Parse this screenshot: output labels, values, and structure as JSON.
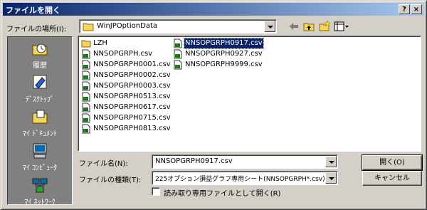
{
  "window": {
    "title": "ファイルを開く",
    "help_button": "?",
    "close_button": "×"
  },
  "location": {
    "label": "ファイルの場所(I):",
    "value": "WinJPOptionData",
    "folder_icon": "folder-icon"
  },
  "toolbar": {
    "back_icon": "back-arrow-icon",
    "up_icon": "up-folder-icon",
    "new_folder_icon": "new-folder-icon",
    "view_icon": "view-menu-icon"
  },
  "places": [
    {
      "label": "履歴",
      "icon": "history-icon"
    },
    {
      "label": "ﾃﾞｽｸﾄｯﾌﾟ",
      "icon": "desktop-icon"
    },
    {
      "label": "ﾏｲ ﾄﾞｷｭﾒﾝﾄ",
      "icon": "my-documents-icon"
    },
    {
      "label": "ﾏｲ ｺﾝﾋﾟｭｰﾀ",
      "icon": "my-computer-icon"
    },
    {
      "label": "ﾏｲ ﾈｯﾄﾜｰｸ",
      "icon": "my-network-icon"
    }
  ],
  "files": [
    {
      "name": "LZH",
      "type": "folder"
    },
    {
      "name": "NNSOPGRPH.csv",
      "type": "csv"
    },
    {
      "name": "NNSOPGRPH0001.csv",
      "type": "csv"
    },
    {
      "name": "NNSOPGRPH0002.csv",
      "type": "csv"
    },
    {
      "name": "NNSOPGRPH0003.csv",
      "type": "csv"
    },
    {
      "name": "NNSOPGRPH0513.csv",
      "type": "csv"
    },
    {
      "name": "NNSOPGRPH0617.csv",
      "type": "csv"
    },
    {
      "name": "NNSOPGRPH0715.csv",
      "type": "csv"
    },
    {
      "name": "NNSOPGRPH0813.csv",
      "type": "csv"
    },
    {
      "name": "NNSOPGRPH0917.csv",
      "type": "csv",
      "selected": true
    },
    {
      "name": "NNSOPGRPH0927.csv",
      "type": "csv"
    },
    {
      "name": "NNSOPGRPH9999.csv",
      "type": "csv"
    }
  ],
  "filename": {
    "label": "ファイル名(N):",
    "value": "NNSOPGRPH0917.csv"
  },
  "filetype": {
    "label": "ファイルの種類(T):",
    "value": "225オプション損益グラフ専用シート(NNSOPGRPH*.csv)"
  },
  "readonly": {
    "label": "読み取り専用ファイルとして開く(R)",
    "checked": false
  },
  "buttons": {
    "open": "開く(O)",
    "cancel": "キャンセル"
  }
}
